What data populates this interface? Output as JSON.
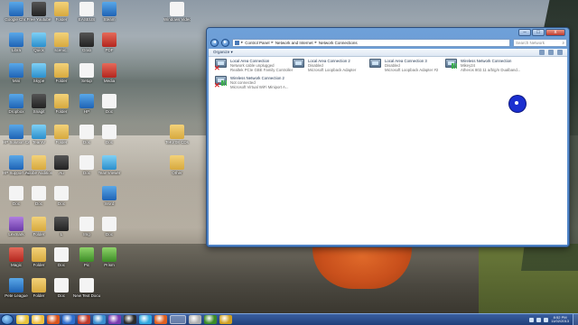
{
  "desktop": {
    "icons": [
      {
        "label": "Google Chr..",
        "icon": "chrome-icon",
        "color": "g-blue"
      },
      {
        "label": "Free Youtube",
        "icon": "video-icon",
        "color": "g-dark"
      },
      {
        "label": "Folder",
        "icon": "folder-icon",
        "color": "g-folder"
      },
      {
        "label": "EASEUS",
        "icon": "app-icon",
        "color": "g-white"
      },
      {
        "label": "Steam",
        "icon": "steam-icon",
        "color": "g-blue"
      },
      {
        "label": "Windows Video Ma...",
        "icon": "video-icon",
        "color": "g-white"
      },
      {
        "label": "Libra",
        "icon": "library-icon",
        "color": "g-blue"
      },
      {
        "label": "Quick",
        "icon": "quicktime-icon",
        "color": "g-sky"
      },
      {
        "label": "scenic..",
        "icon": "folder-icon",
        "color": "g-folder"
      },
      {
        "label": "Grab",
        "icon": "app-icon",
        "color": "g-dark"
      },
      {
        "label": "PDF",
        "icon": "pdf-icon",
        "color": "g-red"
      },
      {
        "label": "Mini",
        "icon": "app-icon",
        "color": "g-blue"
      },
      {
        "label": "Skype",
        "icon": "skype-icon",
        "color": "g-sky"
      },
      {
        "label": "Folder",
        "icon": "folder-icon",
        "color": "g-folder"
      },
      {
        "label": "Setup",
        "icon": "setup-icon",
        "color": "g-white"
      },
      {
        "label": "Media",
        "icon": "media-icon",
        "color": "g-red"
      },
      {
        "label": "Dropbox",
        "icon": "dropbox-icon",
        "color": "g-blue"
      },
      {
        "label": "Snagit",
        "icon": "snagit-icon",
        "color": "g-dark"
      },
      {
        "label": "Folder",
        "icon": "folder-icon",
        "color": "g-folder"
      },
      {
        "label": "HP",
        "icon": "hp-icon",
        "color": "g-blue"
      },
      {
        "label": "Doc",
        "icon": "document-icon",
        "color": "g-white"
      },
      {
        "label": "HP Solution Center",
        "icon": "hp-icon",
        "color": "g-blue"
      },
      {
        "label": "TeamV",
        "icon": "teamviewer-icon",
        "color": "g-sky"
      },
      {
        "label": "Folder",
        "icon": "folder-icon",
        "color": "g-folder"
      },
      {
        "label": "Doc",
        "icon": "document-icon",
        "color": "g-white"
      },
      {
        "label": "Doc",
        "icon": "document-icon",
        "color": "g-white"
      },
      {
        "label": "TeKrr08 CDs",
        "icon": "folder-icon",
        "color": "g-folder"
      },
      {
        "label": "HP Support Assistant",
        "icon": "hp-icon",
        "color": "g-blue"
      },
      {
        "label": "Adobe Audition",
        "icon": "folder-icon",
        "color": "g-folder"
      },
      {
        "label": "Au",
        "icon": "audition-icon",
        "color": "g-dark"
      },
      {
        "label": "Doc",
        "icon": "document-icon",
        "color": "g-white"
      },
      {
        "label": "TeamViewer",
        "icon": "teamviewer-icon",
        "color": "g-sky"
      },
      {
        "label": "Other",
        "icon": "folder-icon",
        "color": "g-folder"
      },
      {
        "label": "Doc",
        "icon": "document-icon",
        "color": "g-white"
      },
      {
        "label": "Doc",
        "icon": "document-icon",
        "color": "g-white"
      },
      {
        "label": "Doc",
        "icon": "document-icon",
        "color": "g-white"
      },
      {
        "label": "Word",
        "icon": "word-icon",
        "color": "g-blue"
      },
      {
        "label": "Lexmark",
        "icon": "printer-icon",
        "color": "g-purple"
      },
      {
        "label": "Folder",
        "icon": "folder-icon",
        "color": "g-folder"
      },
      {
        "label": "L",
        "icon": "app-icon",
        "color": "g-dark"
      },
      {
        "label": "Img",
        "icon": "image-icon",
        "color": "g-white"
      },
      {
        "label": "Doc",
        "icon": "document-icon",
        "color": "g-white"
      },
      {
        "label": "Magic",
        "icon": "app-icon",
        "color": "g-red"
      },
      {
        "label": "Folder",
        "icon": "folder-icon",
        "color": "g-folder"
      },
      {
        "label": "Doc",
        "icon": "document-icon",
        "color": "g-white"
      },
      {
        "label": "Pic",
        "icon": "image-icon",
        "color": "g-green"
      },
      {
        "label": "Prism",
        "icon": "app-icon",
        "color": "g-green"
      },
      {
        "label": "Pete League",
        "icon": "app-icon",
        "color": "g-blue"
      },
      {
        "label": "Folder",
        "icon": "folder-icon",
        "color": "g-folder"
      },
      {
        "label": "Doc",
        "icon": "document-icon",
        "color": "g-white"
      },
      {
        "label": "New Text Document",
        "icon": "document-icon",
        "color": "g-white"
      }
    ]
  },
  "window": {
    "min": "–",
    "max": "□",
    "close": "x",
    "back": "◂",
    "forward": "▸",
    "breadcrumb": [
      "Control Panel",
      "Network and Internet",
      "Network Connections"
    ],
    "search_placeholder": "Search Network Connections",
    "toolbar": {
      "organize": "Organize ▾"
    },
    "connections": [
      {
        "name": "Local Area Connection",
        "status": "Network cable unplugged",
        "adapter": "Realtek PCIe GBE Family Controller",
        "icon": "ethernet-icon",
        "error": true
      },
      {
        "name": "Local Area Connection 2",
        "status": "Disabled",
        "adapter": "Microsoft Loopback Adapter",
        "icon": "ethernet-icon",
        "error": false
      },
      {
        "name": "Local Area Connection 3",
        "status": "Disabled",
        "adapter": "Microsoft Loopback Adapter #2",
        "icon": "ethernet-icon",
        "error": false
      },
      {
        "name": "Wireless Network Connection",
        "status": "Mikey24",
        "adapter": "Atheros 802.11 a/b/g/n Dualband...",
        "icon": "wireless-icon",
        "error": false
      },
      {
        "name": "Wireless Network Connection 2",
        "status": "Not connected",
        "adapter": "Microsoft Virtual WiFi Miniport A...",
        "icon": "wireless-icon",
        "error": true
      }
    ]
  },
  "taskbar": {
    "apps": [
      "chrome-icon",
      "explorer-icon",
      "media-icon",
      "app-icon",
      "app-icon",
      "app-icon",
      "app-icon",
      "app-icon",
      "skype-icon",
      "app-icon",
      "network-icon",
      "app-icon",
      "app-icon",
      "app-icon"
    ],
    "time": "8:52 PM",
    "date": "11/02/2013"
  }
}
